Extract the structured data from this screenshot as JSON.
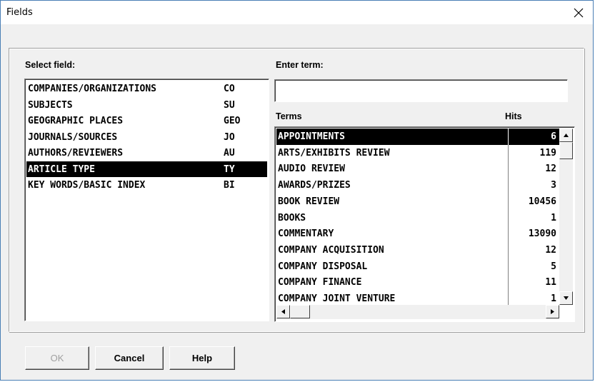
{
  "window": {
    "title": "Fields"
  },
  "left": {
    "label": "Select field:",
    "fields": [
      {
        "name": "COMPANIES/ORGANIZATIONS",
        "code": "CO",
        "selected": false
      },
      {
        "name": "SUBJECTS",
        "code": "SU",
        "selected": false
      },
      {
        "name": "GEOGRAPHIC PLACES",
        "code": "GEO",
        "selected": false
      },
      {
        "name": "JOURNALS/SOURCES",
        "code": "JO",
        "selected": false
      },
      {
        "name": "AUTHORS/REVIEWERS",
        "code": "AU",
        "selected": false
      },
      {
        "name": "ARTICLE TYPE",
        "code": "TY",
        "selected": true
      },
      {
        "name": "KEY WORDS/BASIC INDEX",
        "code": "BI",
        "selected": false
      }
    ]
  },
  "right": {
    "label": "Enter term:",
    "term_value": "",
    "terms_header": "Terms",
    "hits_header": "Hits",
    "terms": [
      {
        "name": "APPOINTMENTS",
        "hits": "6",
        "selected": true
      },
      {
        "name": "ARTS/EXHIBITS REVIEW",
        "hits": "119",
        "selected": false
      },
      {
        "name": "AUDIO REVIEW",
        "hits": "12",
        "selected": false
      },
      {
        "name": "AWARDS/PRIZES",
        "hits": "3",
        "selected": false
      },
      {
        "name": "BOOK REVIEW",
        "hits": "10456",
        "selected": false
      },
      {
        "name": "BOOKS",
        "hits": "1",
        "selected": false
      },
      {
        "name": "COMMENTARY",
        "hits": "13090",
        "selected": false
      },
      {
        "name": "COMPANY ACQUISITION",
        "hits": "12",
        "selected": false
      },
      {
        "name": "COMPANY DISPOSAL",
        "hits": "5",
        "selected": false
      },
      {
        "name": "COMPANY FINANCE",
        "hits": "11",
        "selected": false
      },
      {
        "name": "COMPANY JOINT VENTURE",
        "hits": "1",
        "selected": false
      }
    ]
  },
  "buttons": {
    "ok": {
      "label": "OK",
      "enabled": false
    },
    "cancel": {
      "label": "Cancel",
      "enabled": true
    },
    "help": {
      "label": "Help",
      "enabled": true
    }
  },
  "icons": {
    "close": "close-icon",
    "scroll_up": "arrow-up-icon",
    "scroll_down": "arrow-down-icon",
    "scroll_left": "arrow-left-icon",
    "scroll_right": "arrow-right-icon"
  }
}
